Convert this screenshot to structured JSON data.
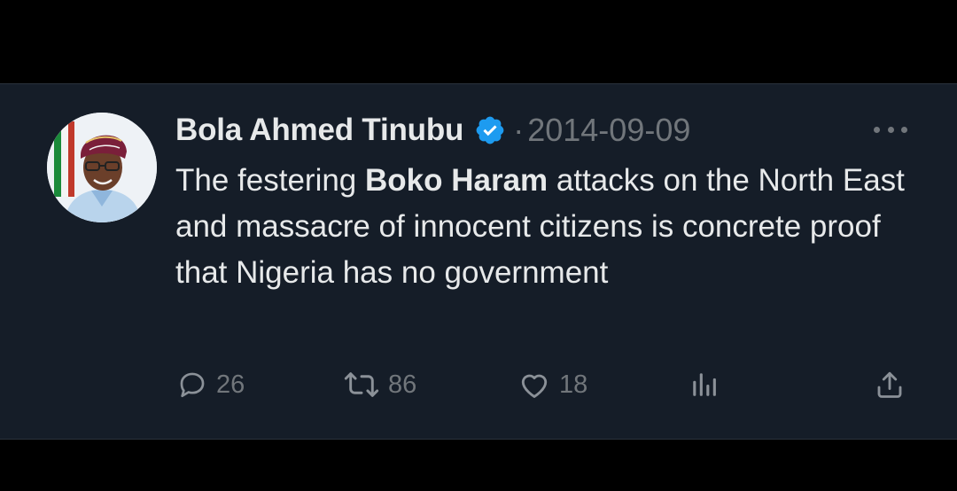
{
  "tweet": {
    "author_name": "Bola Ahmed Tinubu",
    "separator": "·",
    "date": "2014-09-09",
    "text_part1": "The festering ",
    "text_bold": "Boko Haram",
    "text_part2": " attacks on the North East and massacre of innocent citizens is concrete proof that Nigeria has no government"
  },
  "actions": {
    "replies": "26",
    "retweets": "86",
    "likes": "18"
  },
  "icons": {
    "verified": "verified-badge-icon",
    "more": "more-dots-icon",
    "reply": "reply-bubble-icon",
    "retweet": "retweet-icon",
    "like": "heart-icon",
    "views": "views-bar-chart-icon",
    "share": "share-upload-icon"
  },
  "colors": {
    "background": "#151d28",
    "text": "#e7e9ea",
    "muted": "#71767b",
    "verified": "#1d9bf0"
  }
}
